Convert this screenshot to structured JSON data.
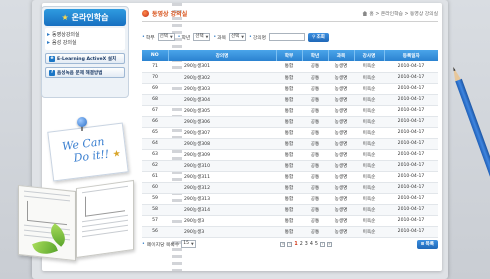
{
  "sidebar": {
    "title": "온라인학습",
    "menu": [
      "동영상강의실",
      "음성 강의실"
    ],
    "buttons": [
      "E-Learning ActiveX 설치",
      "음성녹음 문제 해결방법"
    ]
  },
  "note": {
    "line1": "We Can",
    "line2": "Do it!!"
  },
  "header": {
    "title": "동영상 강의실",
    "breadcrumb": "홈 > 온라인학습 > 동영상 강의실"
  },
  "search": {
    "fields": [
      {
        "label": "학부",
        "value": "선택"
      },
      {
        "label": "학년",
        "value": "선택"
      },
      {
        "label": "과목",
        "value": "선택"
      },
      {
        "label": "강의명",
        "value": ""
      }
    ],
    "button": "조회"
  },
  "table": {
    "columns": [
      "NO",
      "강의명",
      "학부",
      "학년",
      "과목",
      "강사명",
      "등록일자"
    ],
    "rows": [
      [
        "71",
        "290농생301",
        "통합",
        "공통",
        "농생명",
        "이옥순",
        "2010-04-17"
      ],
      [
        "70",
        "290농생302",
        "통합",
        "공통",
        "농생명",
        "이옥순",
        "2010-04-17"
      ],
      [
        "69",
        "290농생303",
        "통합",
        "공통",
        "농생명",
        "이옥순",
        "2010-04-17"
      ],
      [
        "68",
        "290농생304",
        "통합",
        "공통",
        "농생명",
        "이옥순",
        "2010-04-17"
      ],
      [
        "67",
        "290농생305",
        "통합",
        "공통",
        "농생명",
        "이옥순",
        "2010-04-17"
      ],
      [
        "66",
        "290농생306",
        "통합",
        "공통",
        "농생명",
        "이옥순",
        "2010-04-17"
      ],
      [
        "65",
        "290농생307",
        "통합",
        "공통",
        "농생명",
        "이옥순",
        "2010-04-17"
      ],
      [
        "64",
        "290농생308",
        "통합",
        "공통",
        "농생명",
        "이옥순",
        "2010-04-17"
      ],
      [
        "63",
        "290농생309",
        "통합",
        "공통",
        "농생명",
        "이옥순",
        "2010-04-17"
      ],
      [
        "62",
        "290농생310",
        "통합",
        "공통",
        "농생명",
        "이옥순",
        "2010-04-17"
      ],
      [
        "61",
        "290농생311",
        "통합",
        "공통",
        "농생명",
        "이옥순",
        "2010-04-17"
      ],
      [
        "60",
        "290농생312",
        "통합",
        "공통",
        "농생명",
        "이옥순",
        "2010-04-17"
      ],
      [
        "59",
        "290농생313",
        "통합",
        "공통",
        "농생명",
        "이옥순",
        "2010-04-17"
      ],
      [
        "58",
        "290농생314",
        "통합",
        "공통",
        "농생명",
        "이옥순",
        "2010-04-17"
      ],
      [
        "57",
        "290농생3",
        "통합",
        "공통",
        "농생명",
        "이옥순",
        "2010-04-17"
      ],
      [
        "56",
        "290농생3",
        "통합",
        "공통",
        "농생명",
        "이옥순",
        "2010-04-17"
      ]
    ]
  },
  "footer": {
    "rows_label": "페이지당 목록수",
    "rows_value": "15",
    "pages": [
      "1",
      "2",
      "3",
      "4",
      "5"
    ],
    "current_page": "1",
    "list_button": "목록"
  }
}
